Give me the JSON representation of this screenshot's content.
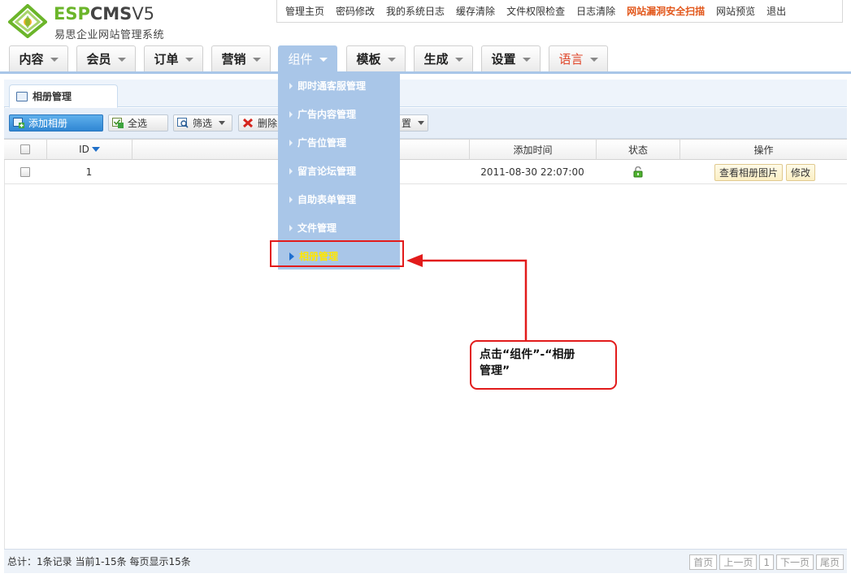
{
  "logo": {
    "brand_esp": "ESP",
    "brand_cms": "CMS",
    "brand_ver": "V5",
    "subtitle": "易思企业网站管理系统"
  },
  "topbar": {
    "links": [
      "管理主页",
      "密码修改",
      "我的系统日志",
      "缓存清除",
      "文件权限检查",
      "日志清除",
      "网站漏洞安全扫描",
      "网站预览",
      "退出"
    ],
    "highlight_color": "#e2571b"
  },
  "mainnav": {
    "tabs": [
      "内容",
      "会员",
      "订单",
      "营销",
      "组件",
      "模板",
      "生成",
      "设置",
      "语言"
    ],
    "active": "组件",
    "active_color": "#a9c6e8"
  },
  "subtab": {
    "label": "相册管理"
  },
  "toolbar": {
    "add": "添加相册",
    "select_all": "全选",
    "filter": "筛选",
    "delete": "删除",
    "settings": "置"
  },
  "table": {
    "headers": {
      "id": "ID",
      "time": "添加时间",
      "status": "状态",
      "ops": "操作"
    },
    "rows": [
      {
        "id": "1",
        "time": "2011-08-30 22:07:00",
        "status": "unlocked-icon",
        "view": "查看相册图片",
        "edit": "修改"
      }
    ]
  },
  "dropdown": {
    "items": [
      "即时通客服管理",
      "广告内容管理",
      "广告位管理",
      "留言论坛管理",
      "自助表单管理",
      "文件管理",
      "相册管理"
    ],
    "active": "相册管理",
    "active_text_color": "#ffe600"
  },
  "annotation": {
    "line1": "点击“组件”-“相册",
    "line2": "管理”",
    "color": "#e21b1b"
  },
  "footer": {
    "summary": "总计：1条记录 当前1-15条 每页显示15条",
    "pager": [
      "首页",
      "上一页",
      "1",
      "下一页",
      "尾页"
    ]
  }
}
